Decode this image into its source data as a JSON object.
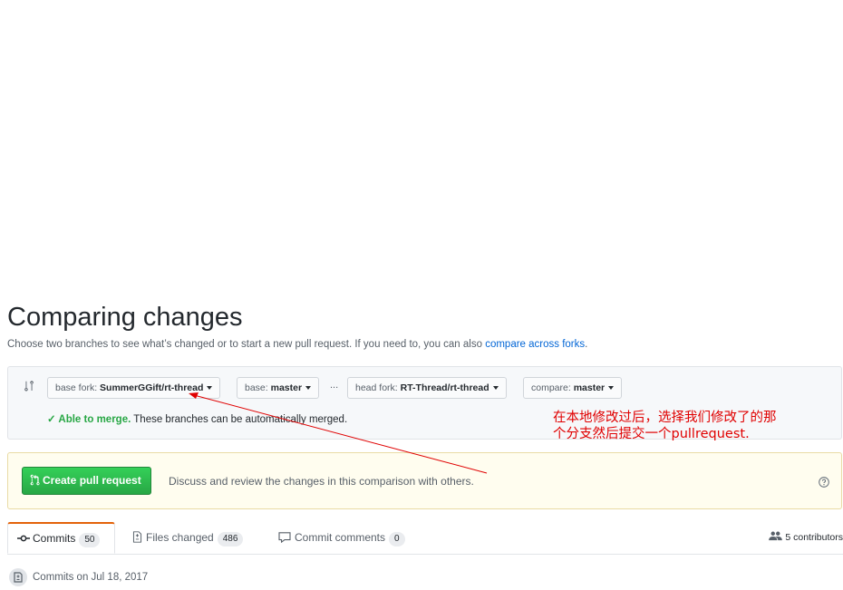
{
  "page": {
    "title": "Comparing changes",
    "subtitle": "Choose two branches to see what’s changed or to start a new pull request. If you need to, you can also ",
    "subtitle_link": "compare across forks",
    "subtitle_end": "."
  },
  "range": {
    "base_fork_label": "base fork: ",
    "base_fork_value": "SummerGGift/rt-thread",
    "base_label": "base: ",
    "base_value": "master",
    "dots": "...",
    "head_fork_label": "head fork: ",
    "head_fork_value": "RT-Thread/rt-thread",
    "compare_label": "compare: ",
    "compare_value": "master",
    "merge_ok": "✓ Able to merge.",
    "merge_text": " These branches can be automatically merged."
  },
  "pr": {
    "button_label": "Create pull request",
    "description": "Discuss and review the changes in this comparison with others."
  },
  "tabs": [
    {
      "label": "Commits",
      "count": "50"
    },
    {
      "label": "Files changed",
      "count": "486"
    },
    {
      "label": "Commit comments",
      "count": "0"
    }
  ],
  "contributors": "5 contributors",
  "commits_header": "Commits on Jul 18, 2017",
  "annotation": {
    "line1": "在本地修改过后，选择我们修改了的那",
    "line2": "个分支然后提交一个pullrequest.",
    "color": "#e00000"
  },
  "colors": {
    "accent_green": "#28a745",
    "link_blue": "#0366d6",
    "tab_accent": "#e36209"
  }
}
